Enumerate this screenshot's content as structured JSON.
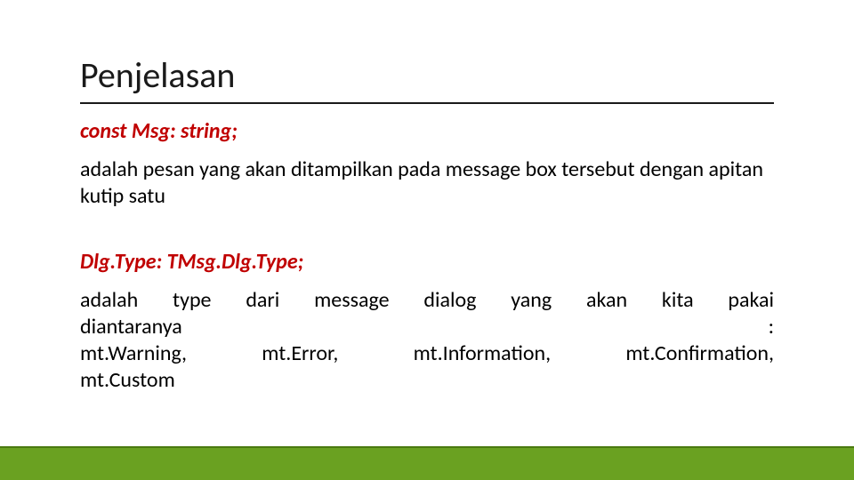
{
  "title": "Penjelasan",
  "section1": {
    "code": "const Msg: string;",
    "desc": "adalah pesan yang akan ditampilkan pada message box tersebut dengan apitan kutip satu"
  },
  "section2": {
    "code": "Dlg.Type: TMsg.Dlg.Type;",
    "desc_line1": "adalah type dari message dialog yang akan kita pakai",
    "desc_line2_left": "diantaranya",
    "desc_line2_right": ":",
    "desc_line3_a": "mt.Warning,",
    "desc_line3_b": "mt.Error,",
    "desc_line3_c": "mt.Information,",
    "desc_line3_d": "mt.Confirmation,",
    "desc_line4": "mt.Custom"
  }
}
